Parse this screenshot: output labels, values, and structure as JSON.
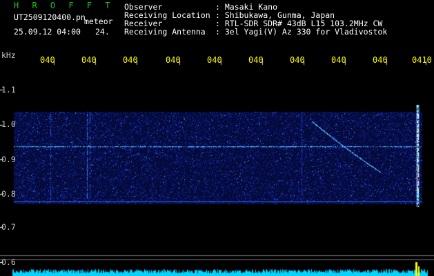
{
  "header": {
    "station": "H R O F F T",
    "filename": "UT2509120400.pn",
    "type": "meteor",
    "datetime": "25.09.12 04:00",
    "frame": "24.",
    "rows": [
      {
        "label": "Observer",
        "value": ": Masaki Kano"
      },
      {
        "label": "Receiving Location",
        "value": ": Shibukawa, Gunma, Japan"
      },
      {
        "label": "Receiver",
        "value": ": RTL-SDR SDR# 43dB L15 103.2MHz CW"
      },
      {
        "label": "Receiving Antenna",
        "value": ": 3el Yagi(V) Az 330 for Vladivostok"
      }
    ]
  },
  "y_axis": {
    "unit": "kHz",
    "ticks": [
      "1.1",
      "1.0",
      "0.9",
      "0.8",
      "0.7",
      "0.6"
    ]
  },
  "time_axis": {
    "ticks": [
      "040",
      "040",
      "040",
      "040",
      "040",
      "040",
      "040",
      "040",
      "040",
      "0410"
    ]
  },
  "colors": {
    "background": "#000000",
    "text": "#ffffff",
    "station": "#19c419",
    "time_labels": "#ffff00",
    "noise_band": "#0a1a8c",
    "signal_line": "#39a0ff",
    "meteor_echo": "#ffffff",
    "power_bar": "#00d4ff"
  }
}
